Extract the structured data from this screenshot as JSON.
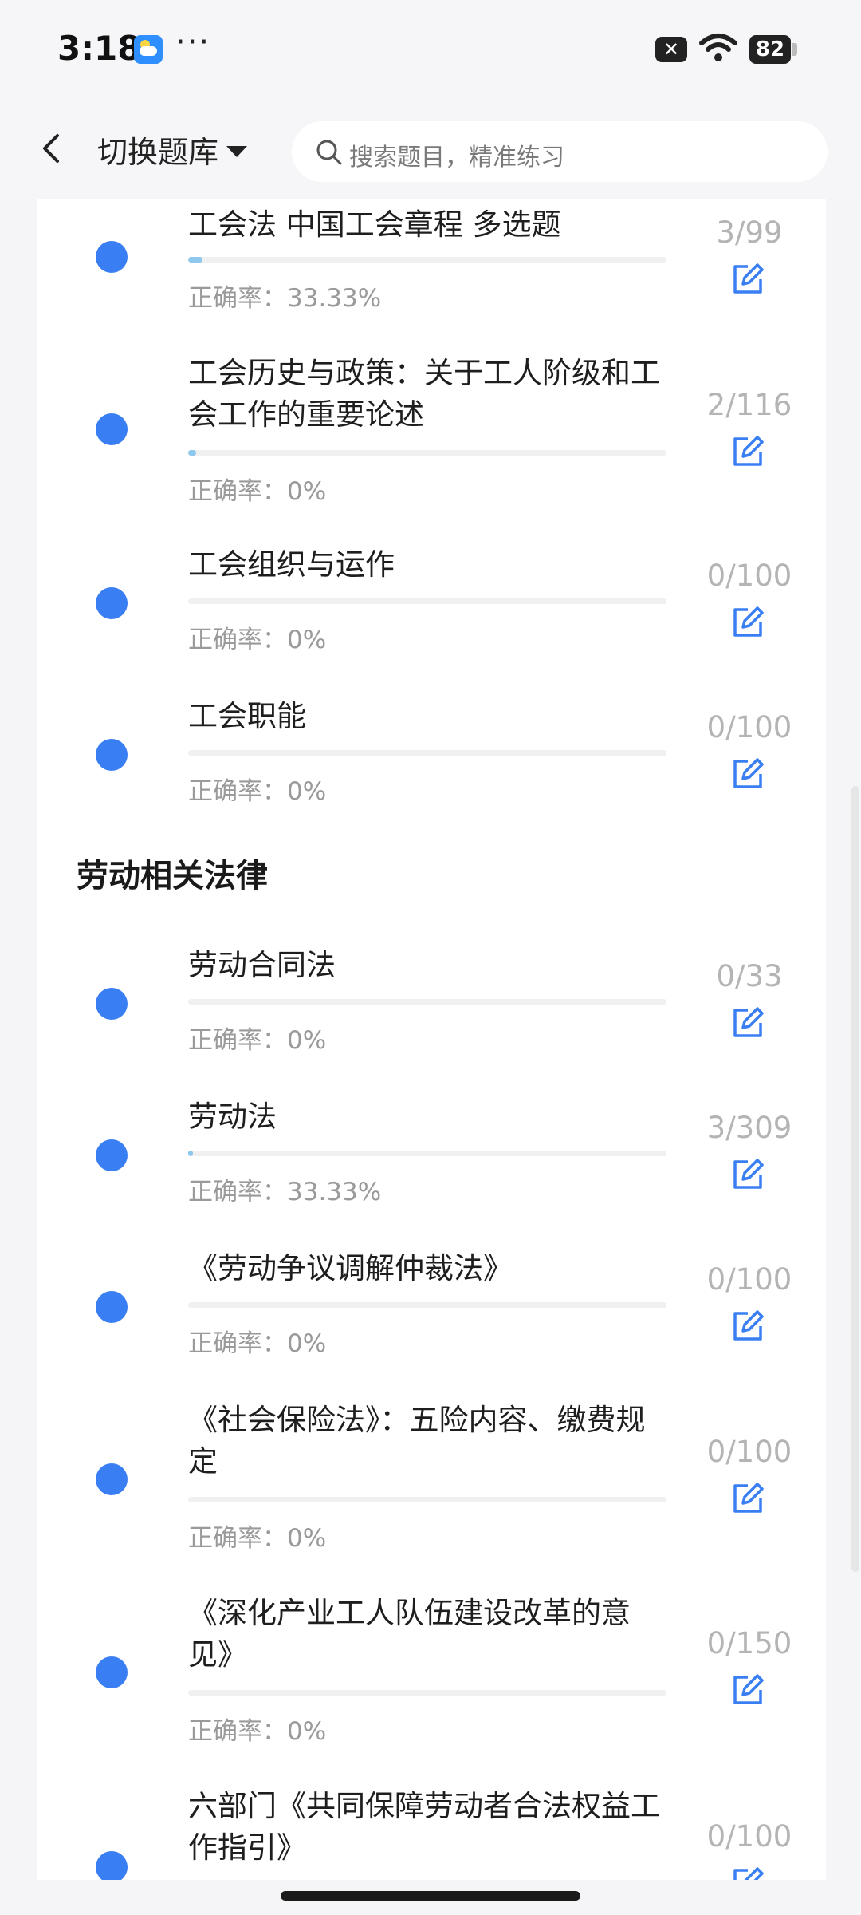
{
  "status_bar": {
    "time": "3:18",
    "dots": "···",
    "battery": "82"
  },
  "header": {
    "switch_label": "切换题库",
    "search_placeholder": "搜索题目，精准练习"
  },
  "section_labor": "劳动相关法律",
  "items": [
    {
      "title": "工会法 中国工会章程 多选题",
      "count": "3/99",
      "accuracy": "正确率：33.33%",
      "progress": 0.03
    },
    {
      "title": "工会历史与政策：关于工人阶级和工会工作的重要论述",
      "count": "2/116",
      "accuracy": "正确率：0%",
      "progress": 0.017
    },
    {
      "title": "工会组织与运作",
      "count": "0/100",
      "accuracy": "正确率：0%",
      "progress": 0
    },
    {
      "title": "工会职能",
      "count": "0/100",
      "accuracy": "正确率：0%",
      "progress": 0
    },
    {
      "title": "劳动合同法",
      "count": "0/33",
      "accuracy": "正确率：0%",
      "progress": 0
    },
    {
      "title": "劳动法",
      "count": "3/309",
      "accuracy": "正确率：33.33%",
      "progress": 0.01
    },
    {
      "title": "《劳动争议调解仲裁法》",
      "count": "0/100",
      "accuracy": "正确率：0%",
      "progress": 0
    },
    {
      "title": "《社会保险法》：五险内容、缴费规定",
      "count": "0/100",
      "accuracy": "正确率：0%",
      "progress": 0
    },
    {
      "title": "《深化产业工人队伍建设改革的意见》",
      "count": "0/150",
      "accuracy": "正确率：0%",
      "progress": 0
    },
    {
      "title": "六部门《共同保障劳动者合法权益工作指引》",
      "count": "0/100",
      "accuracy": "",
      "progress": 0
    }
  ]
}
